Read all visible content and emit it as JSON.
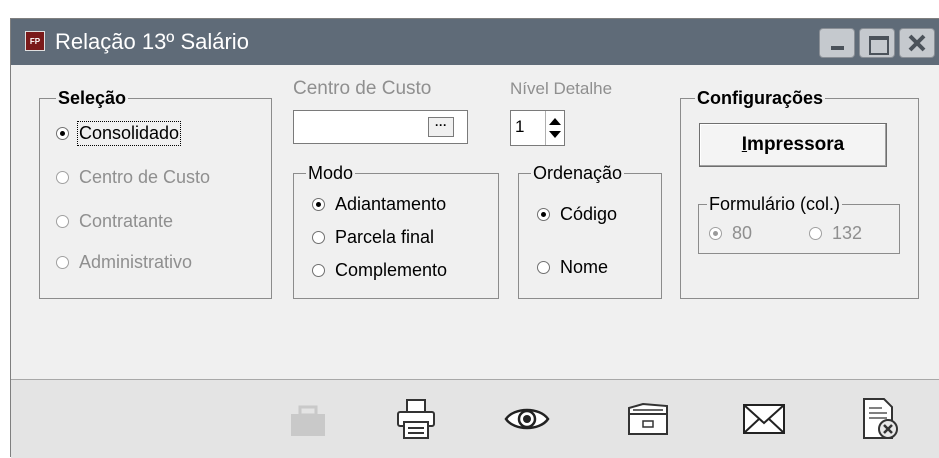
{
  "window": {
    "title": "Relação 13º Salário",
    "app_icon": "FP"
  },
  "selecao": {
    "legend": "Seleção",
    "options": [
      "Consolidado",
      "Centro de Custo",
      "Contratante",
      "Administrativo"
    ],
    "selected": "Consolidado"
  },
  "centro_custo": {
    "label": "Centro de Custo",
    "value": "",
    "browse_label": "···"
  },
  "nivel_detalhe": {
    "label": "Nível Detalhe",
    "value": "1"
  },
  "modo": {
    "legend": "Modo",
    "options": [
      "Adiantamento",
      "Parcela final",
      "Complemento"
    ],
    "selected": "Adiantamento"
  },
  "ordenacao": {
    "legend": "Ordenação",
    "options": [
      "Código",
      "Nome"
    ],
    "selected": "Código"
  },
  "configuracoes": {
    "legend": "Configurações",
    "printer_button_hotkey": "I",
    "printer_button_rest": "mpressora",
    "formulario": {
      "legend": "Formulário (col.)",
      "options": [
        "80",
        "132"
      ],
      "selected": "80"
    }
  },
  "toolbar": {
    "icons": [
      "briefcase-icon",
      "printer-icon",
      "eye-icon",
      "folder-icon",
      "envelope-icon",
      "document-close-icon"
    ]
  },
  "colors": {
    "titlebar": "#5f6b78",
    "window_bg": "#f0f0f0",
    "toolbar_bg": "#e4e4e4"
  }
}
